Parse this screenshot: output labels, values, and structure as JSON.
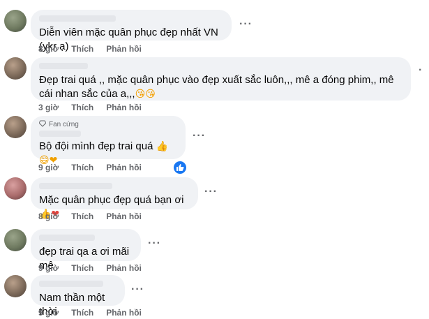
{
  "comments": [
    {
      "text": "Diễn viên mặc quân phục đẹp nhất VN (ykr ạ)",
      "time": "8 giờ",
      "like": "Thích",
      "reply": "Phản hồi"
    },
    {
      "text": "Đẹp trai quá ,, mặc quân phục vào đẹp xuất sắc luôn,,, mê a đóng phim,, mê cái nhan sắc của a,,,",
      "emojis": "😘😘",
      "time": "3 giờ",
      "like": "Thích",
      "reply": "Phản hồi"
    },
    {
      "badge": "Fan cứng",
      "text": "Bộ đội mình đẹp trai quá",
      "emojis": "👍😄❤",
      "time": "9 giờ",
      "like": "Thích",
      "reply": "Phản hồi"
    },
    {
      "text": "Mặc quân phục đẹp quá bạn ơi",
      "emojis": "👍❤",
      "time": "8 giờ",
      "like": "Thích",
      "reply": "Phản hồi"
    },
    {
      "text": "đẹp trai qa a ơi mãi mê",
      "time": "9 giờ",
      "like": "Thích",
      "reply": "Phản hồi"
    },
    {
      "text": "Nam thần một thời",
      "time": "9 giờ",
      "like": "Thích",
      "reply": "Phản hồi"
    }
  ],
  "icons": {
    "more": "more-options-icon",
    "like_reaction": "like-reaction-icon",
    "badge": "diamond-icon"
  }
}
